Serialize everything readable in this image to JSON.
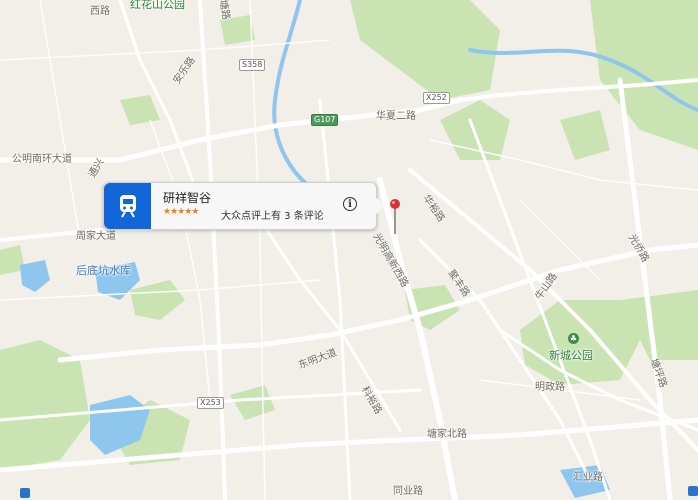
{
  "map": {
    "labels": {
      "honghuashan_park": "红花山公园",
      "anle_road": "安乐路",
      "gongming_nanhuan": "公明南环大道",
      "tongxing": "通兴",
      "zhoujia_road": "周家大道",
      "houdikeng": "后底坑水库",
      "huaxia_road": "华夏二路",
      "hualong_road": "华裕路",
      "guangming_gaoxin_west": "光明高新西路",
      "jingfeng_road": "聚丰路",
      "niushan_road": "牛山路",
      "guangqiao_road": "光侨路",
      "xincheng_park": "新城公园",
      "dongming_road": "东明大道",
      "kelong_road": "科裕路",
      "mingzheng_road": "明政路",
      "tangjia_north": "塘家北路",
      "huiye_road": "汇业路",
      "tongye_road": "同业路",
      "zhengfu_road": "塘坪路",
      "top_road": "塘路",
      "top_xiroad": "西路"
    },
    "shields": {
      "s358": "S358",
      "x252": "X252",
      "x253": "X253",
      "small": "G107"
    }
  },
  "callout": {
    "title": "研祥智谷",
    "stars": "★★★★★",
    "review": "大众点评上有 3 条评论",
    "info": "i",
    "icon": "train-icon"
  },
  "colors": {
    "land": "#f2efe9",
    "park": "#c9e3b2",
    "water": "#8fc6ee",
    "road": "#ffffff",
    "callout_icon_bg": "#1167d8",
    "pin": "#d8323a"
  }
}
